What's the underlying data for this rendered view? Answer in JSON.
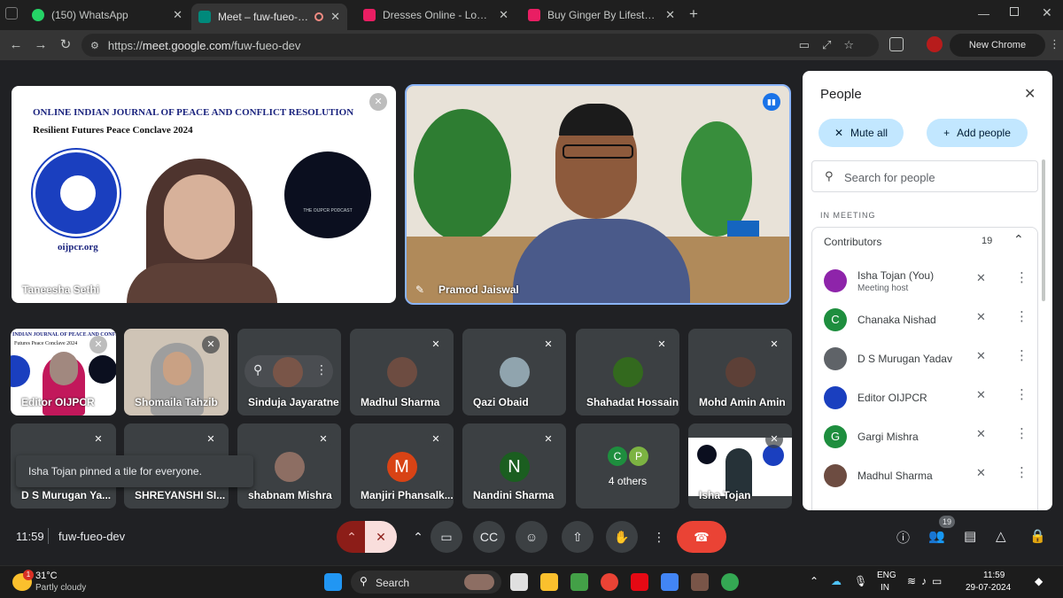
{
  "browser": {
    "tabs": [
      {
        "title": "(150) WhatsApp",
        "color": "#25d366"
      },
      {
        "title": "Meet – fuw-fueo-dev",
        "color": "#00897b"
      },
      {
        "title": "Dresses Online - Low Price Offe",
        "color": "#e91e63"
      },
      {
        "title": "Buy Ginger By Lifestyle Sheath I",
        "color": "#e91e63"
      }
    ],
    "url_prefix": "https://",
    "url_host": "meet.google.com",
    "url_path": "/fuw-fueo-dev",
    "new_chrome": "New Chrome available"
  },
  "main_tiles": [
    {
      "name": "Taneesha Sethi",
      "journal_title": "ONLINE INDIAN JOURNAL OF PEACE AND CONFLICT RESOLUTION",
      "subtitle": "Resilient Futures Peace Conclave 2024",
      "site": "oijpcr.org",
      "podcast": "THE OIJPCR PODCAST"
    },
    {
      "name": "Pramod Jaiswal"
    }
  ],
  "grid_tiles": [
    {
      "name": "Editor OIJPCR",
      "banner": "INDIAN JOURNAL OF PEACE AND CONFLICT RESO",
      "banner2": "Futures Peace Conclave 2024"
    },
    {
      "name": "Shomaila Tahzib"
    },
    {
      "name": "Sinduja Jayaratne"
    },
    {
      "name": "Madhul Sharma"
    },
    {
      "name": "Qazi Obaid"
    },
    {
      "name": "Shahadat Hossain"
    },
    {
      "name": "Mohd Amin Amin"
    },
    {
      "name": "D S Murugan Ya..."
    },
    {
      "name": "SHREYANSHI SI..."
    },
    {
      "name": "shabnam Mishra"
    },
    {
      "name": "Manjiri Phansalk...",
      "letter": "M",
      "color": "#d84315"
    },
    {
      "name": "Nandini Sharma",
      "letter": "N",
      "color": "#1b5e20"
    },
    {
      "name": "4 others",
      "letters": [
        "C",
        "P"
      ]
    },
    {
      "name": "Isha Tojan"
    }
  ],
  "toast": "Isha Tojan pinned a tile for everyone.",
  "people": {
    "title": "People",
    "mute_all": "Mute all",
    "add_people": "Add people",
    "search_placeholder": "Search for people",
    "section": "IN MEETING",
    "group": "Contributors",
    "count": "19",
    "rows": [
      {
        "name": "Isha Tojan (You)",
        "sub": "Meeting host",
        "color": "#8e24aa"
      },
      {
        "name": "Chanaka Nishad",
        "letter": "C",
        "color": "#1e8e3e"
      },
      {
        "name": "D S Murugan Yadav",
        "color": "#5f6368"
      },
      {
        "name": "Editor OIJPCR",
        "color": "#1a3fbf"
      },
      {
        "name": "Gargi Mishra",
        "letter": "G",
        "color": "#1e8e3e"
      },
      {
        "name": "Madhul Sharma",
        "color": "#6d4c41"
      }
    ]
  },
  "controls": {
    "time": "11:59",
    "code": "fuw-fueo-dev",
    "people_badge": "19"
  },
  "taskbar": {
    "temp": "31°C",
    "weather": "Partly cloudy",
    "weather_badge": "1",
    "search": "Search",
    "lang": "ENG",
    "region": "IN",
    "time": "11:59",
    "date": "29-07-2024"
  }
}
